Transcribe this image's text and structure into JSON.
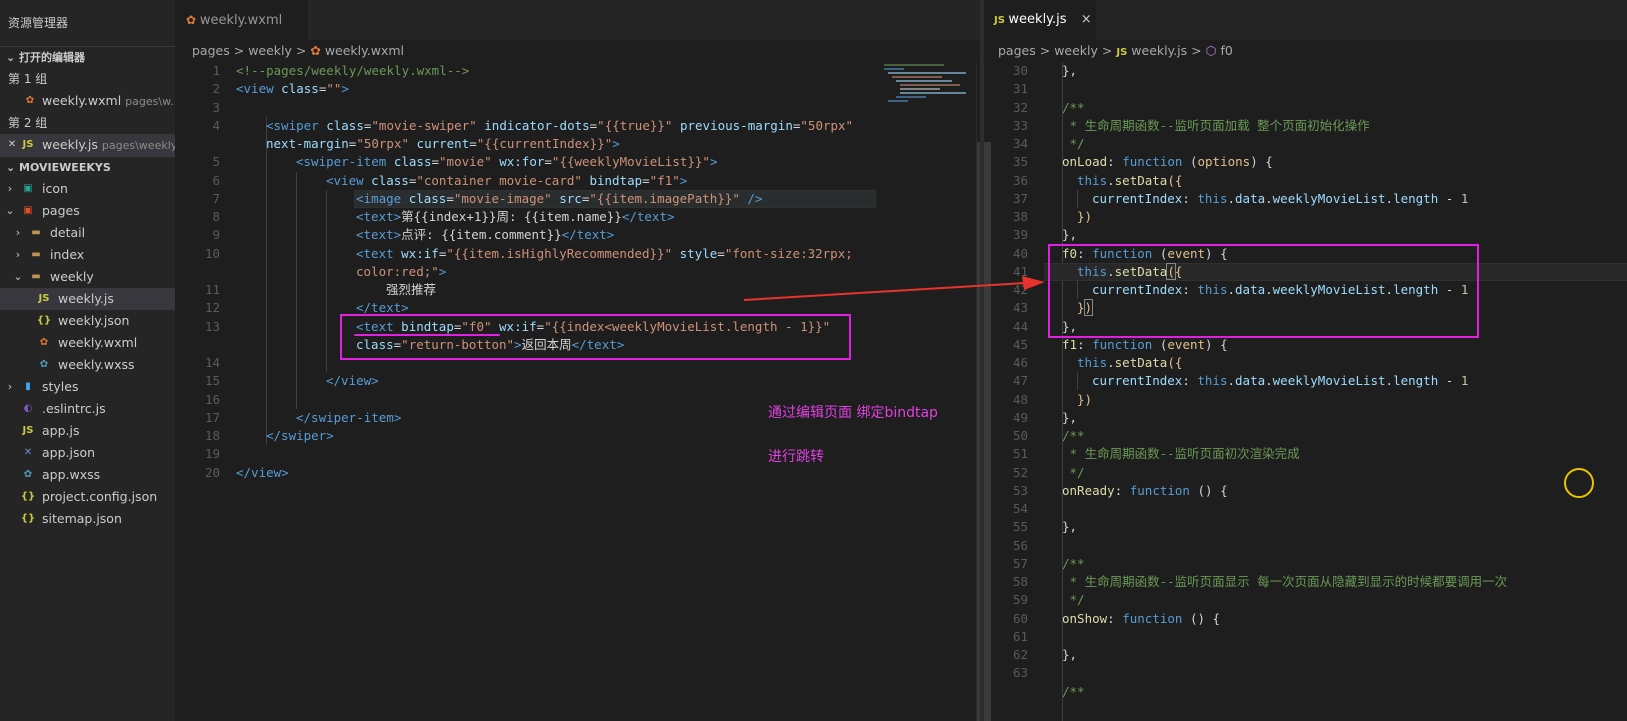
{
  "sidebar": {
    "title": "资源管理器",
    "open_editors": {
      "header": "打开的编辑器",
      "group1": "第 1 组",
      "group1_file": "weekly.wxml",
      "group1_file_path": "pages\\w...",
      "group2": "第 2 组",
      "group2_file": "weekly.js",
      "group2_file_path": "pages\\weekly"
    },
    "project": "MOVIEWEEKYS",
    "tree": [
      {
        "label": "icon"
      },
      {
        "label": "pages"
      },
      {
        "label": "detail"
      },
      {
        "label": "index"
      },
      {
        "label": "weekly"
      },
      {
        "label": "weekly.js"
      },
      {
        "label": "weekly.json"
      },
      {
        "label": "weekly.wxml"
      },
      {
        "label": "weekly.wxss"
      },
      {
        "label": "styles"
      },
      {
        "label": ".eslintrc.js"
      },
      {
        "label": "app.js"
      },
      {
        "label": "app.json"
      },
      {
        "label": "app.wxss"
      },
      {
        "label": "project.config.json"
      },
      {
        "label": "sitemap.json"
      }
    ]
  },
  "left_editor": {
    "tab": "weekly.wxml",
    "more": "···",
    "breadcrumb": {
      "a": "pages",
      "b": "weekly",
      "c": "weekly.wxml",
      "sep": ">"
    },
    "line_numbers": [
      "1",
      "2",
      "3",
      "4",
      "",
      "5",
      "6",
      "7",
      "8",
      "9",
      "10",
      "",
      "11",
      "12",
      "13",
      "",
      "14",
      "15",
      "16",
      "17",
      "18",
      "19",
      "20"
    ],
    "line1": "<!--pages/weekly/weekly.wxml-->",
    "annotation_line1": "通过编辑页面 绑定bindtap",
    "annotation_line2": "进行跳转"
  },
  "right_editor": {
    "tab": "weekly.js",
    "tab_close": "×",
    "breadcrumb": {
      "a": "pages",
      "b": "weekly",
      "c": "weekly.js",
      "d": "f0",
      "sep": ">"
    },
    "line_numbers": [
      "30",
      "31",
      "32",
      "33",
      "34",
      "35",
      "36",
      "37",
      "38",
      "39",
      "40",
      "41",
      "42",
      "43",
      "44",
      "45",
      "46",
      "47",
      "48",
      "49",
      "50",
      "51",
      "52",
      "53",
      "54",
      "55",
      "56",
      "57",
      "58",
      "59",
      "60",
      "61",
      "62",
      "63"
    ],
    "comment_onload": " * 生命周期函数--监听页面加载 整个页面初始化操作",
    "comment_onready": " * 生命周期函数--监听页面初次渲染完成",
    "comment_onshow": " * 生命周期函数--监听页面显示 每一次页面从隐藏到显示的时候都要调用一次"
  },
  "colors": {
    "highlight": "#e020e0",
    "arrow": "#e8322c"
  }
}
